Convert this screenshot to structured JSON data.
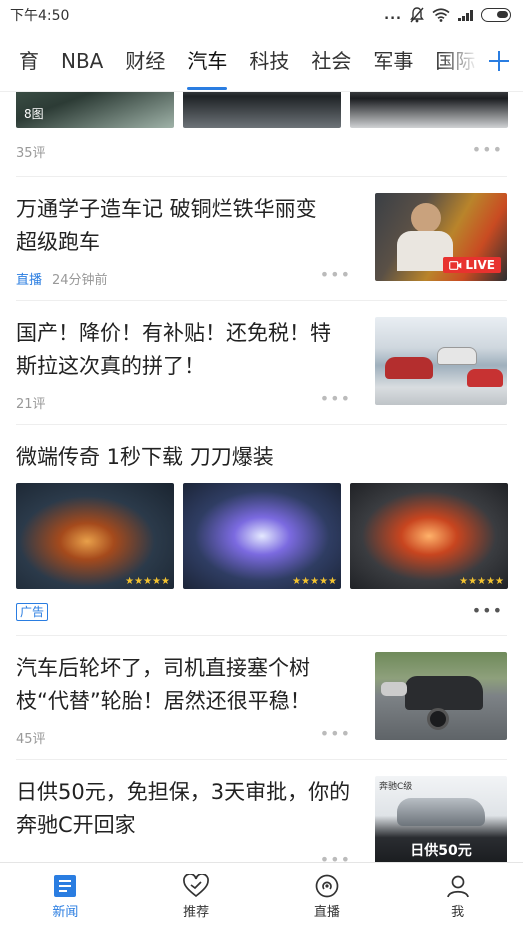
{
  "status_bar": {
    "time": "下午4:50",
    "dots": "...",
    "signal_text": ".ıll"
  },
  "tabs": [
    "育",
    "NBA",
    "财经",
    "汽车",
    "科技",
    "社会",
    "军事",
    "国际"
  ],
  "active_tab": "汽车",
  "feed": {
    "top_gallery": {
      "photo_count": "8图",
      "comments": "35评"
    },
    "items": [
      {
        "title_line1": "万通学子造车记 破铜烂铁华丽变",
        "title_line2": "超级跑车",
        "tag": "直播",
        "time": "24分钟前",
        "badge": "LIVE"
      },
      {
        "title_line1": "国产！降价！有补贴！还免税！特",
        "title_line2": "斯拉这次真的拼了！",
        "comments": "21评"
      },
      {
        "title": "微端传奇 1秒下载 刀刀爆装",
        "ad_label": "广告",
        "stars": "★★★★★"
      },
      {
        "title_line1": "汽车后轮坏了，司机直接塞个树",
        "title_line2": "枝“代替”轮胎！居然还很平稳！",
        "comments": "45评"
      },
      {
        "title_line1": "日供50元，免担保，3天审批，你的",
        "title_line2": "奔驰C开回家",
        "ad_caption": "日供50元",
        "ad_model": "奔驰C级"
      }
    ]
  },
  "more_dots": "•••",
  "bottom_nav": [
    {
      "label": "新闻",
      "icon": "news-icon"
    },
    {
      "label": "推荐",
      "icon": "heart-check-icon"
    },
    {
      "label": "直播",
      "icon": "live-icon"
    },
    {
      "label": "我",
      "icon": "profile-icon"
    }
  ],
  "colors": {
    "accent": "#2a7de1",
    "live_red": "#e8322f"
  }
}
